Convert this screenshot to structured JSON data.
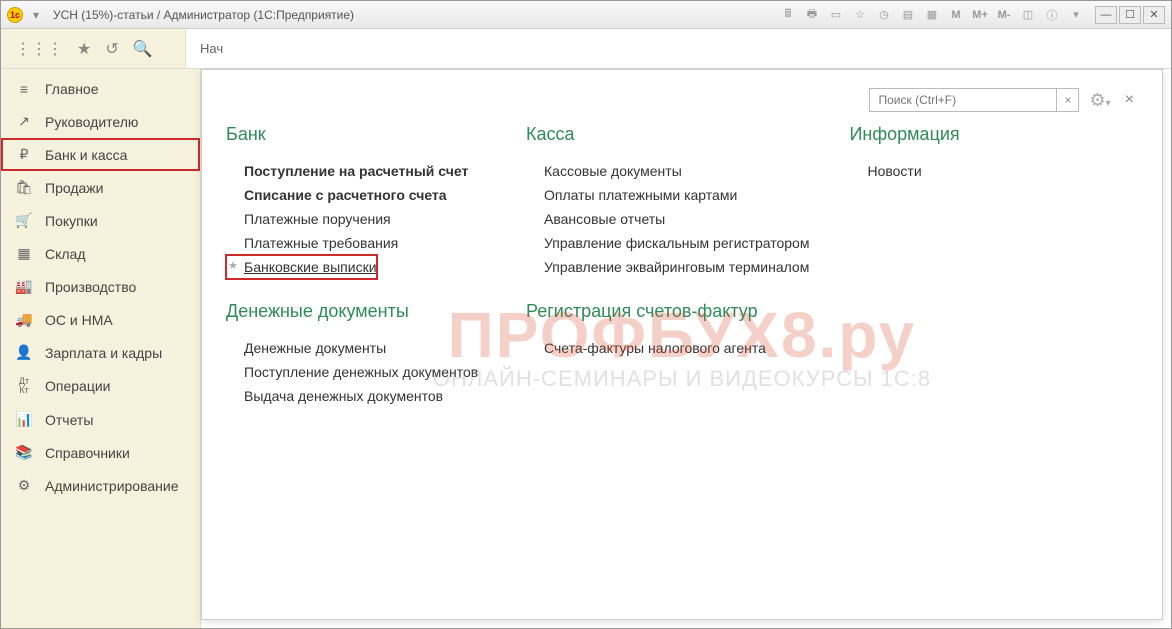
{
  "window": {
    "title": "УСН (15%)-статьи / Администратор  (1С:Предприятие)"
  },
  "toolbar": {
    "tab_hint": "Нач"
  },
  "sidebar": {
    "items": [
      {
        "icon": "≡",
        "label": "Главное"
      },
      {
        "icon": "↗",
        "label": "Руководителю"
      },
      {
        "icon": "₽",
        "label": "Банк и касса",
        "active": true
      },
      {
        "icon": "🛍",
        "label": "Продажи"
      },
      {
        "icon": "🛒",
        "label": "Покупки"
      },
      {
        "icon": "▦",
        "label": "Склад"
      },
      {
        "icon": "🏭",
        "label": "Производство"
      },
      {
        "icon": "🚚",
        "label": "ОС и НМА"
      },
      {
        "icon": "👤",
        "label": "Зарплата и кадры"
      },
      {
        "icon": "Дт Кт",
        "label": "Операции"
      },
      {
        "icon": "📊",
        "label": "Отчеты"
      },
      {
        "icon": "📚",
        "label": "Справочники"
      },
      {
        "icon": "⚙",
        "label": "Администрирование"
      }
    ]
  },
  "panel": {
    "search_placeholder": "Поиск (Ctrl+F)",
    "columns": [
      {
        "title": "Банк",
        "links": [
          {
            "label": "Поступление на расчетный счет",
            "bold": true
          },
          {
            "label": "Списание с расчетного счета",
            "bold": true
          },
          {
            "label": "Платежные поручения"
          },
          {
            "label": "Платежные требования"
          },
          {
            "label": "Банковские выписки",
            "highlight": true
          }
        ],
        "title2": "Денежные документы",
        "links2": [
          {
            "label": "Денежные документы"
          },
          {
            "label": "Поступление денежных документов"
          },
          {
            "label": "Выдача денежных документов"
          }
        ]
      },
      {
        "title": "Касса",
        "links": [
          {
            "label": "Кассовые документы"
          },
          {
            "label": "Оплаты платежными картами"
          },
          {
            "label": "Авансовые отчеты"
          },
          {
            "label": "Управление фискальным регистратором"
          },
          {
            "label": "Управление эквайринговым терминалом"
          }
        ],
        "title2": "Регистрация счетов-фактур",
        "links2": [
          {
            "label": "Счета-фактуры налогового агента"
          }
        ]
      },
      {
        "title": "Информация",
        "links": [
          {
            "label": "Новости"
          }
        ]
      }
    ]
  },
  "watermark": {
    "line1": "ПРОФБУХ8.ру",
    "line2": "ОНЛАЙН-СЕМИНАРЫ И ВИДЕОКУРСЫ 1С:8"
  },
  "titlebar_buttons": {
    "m": "M",
    "mp": "M+",
    "mm": "M-"
  }
}
